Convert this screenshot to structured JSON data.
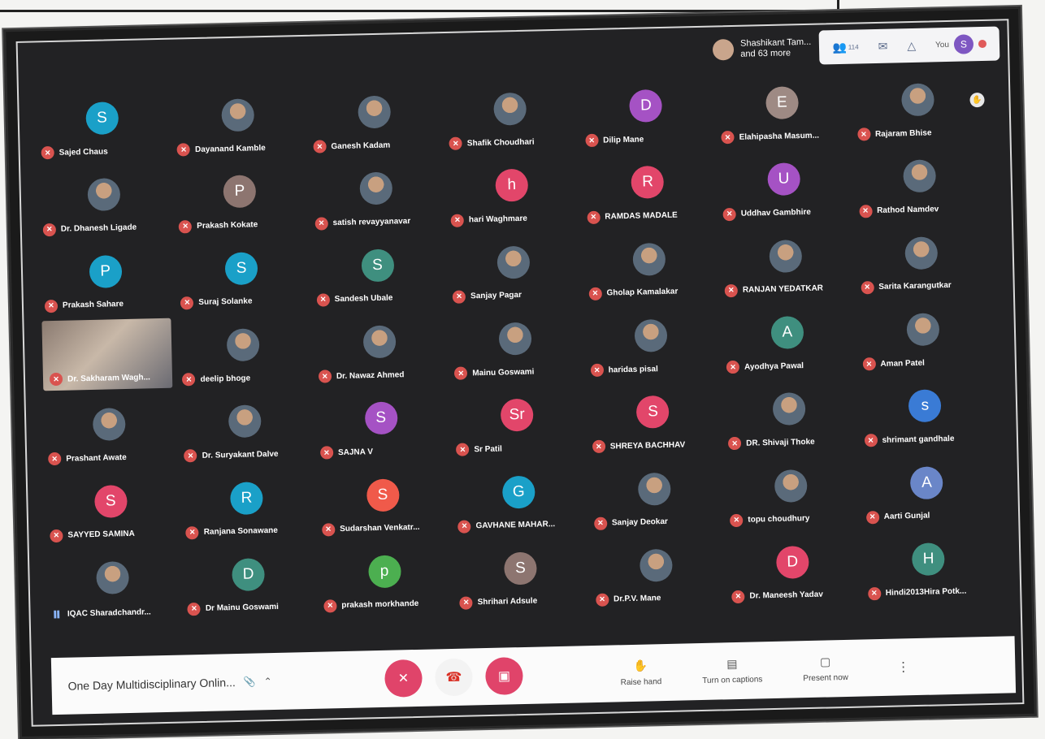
{
  "presenter": {
    "line1": "Shashikant Tam...",
    "line2": "and 63 more"
  },
  "topbar": {
    "participants_count": "114",
    "you_label": "You",
    "you_initial": "S"
  },
  "participants": [
    {
      "name": "Sajed Chaus",
      "initial": "S",
      "color": "#1aa0c8"
    },
    {
      "name": "Dayanand Kamble",
      "photo": true
    },
    {
      "name": "Ganesh Kadam",
      "photo": true
    },
    {
      "name": "Shafik Choudhari",
      "photo": true
    },
    {
      "name": "Dilip Mane",
      "initial": "D",
      "color": "#a552c4"
    },
    {
      "name": "Elahipasha Masum...",
      "initial": "E",
      "color": "#9e8a84"
    },
    {
      "name": "Rajaram Bhise",
      "photo": true,
      "hand": true
    },
    {
      "name": "Dr. Dhanesh Ligade",
      "photo": true
    },
    {
      "name": "Prakash Kokate",
      "initial": "P",
      "color": "#8d7570"
    },
    {
      "name": "satish revayyanavar",
      "photo": true
    },
    {
      "name": "hari Waghmare",
      "initial": "h",
      "color": "#e2466a"
    },
    {
      "name": "RAMDAS MADALE",
      "initial": "R",
      "color": "#e2466a"
    },
    {
      "name": "Uddhav Gambhire",
      "initial": "U",
      "color": "#a552c4"
    },
    {
      "name": "Rathod Namdev",
      "photo": true
    },
    {
      "name": "Prakash Sahare",
      "initial": "P",
      "color": "#1aa0c8"
    },
    {
      "name": "Suraj Solanke",
      "initial": "S",
      "color": "#1aa0c8"
    },
    {
      "name": "Sandesh Ubale",
      "initial": "S",
      "color": "#3f8f7f"
    },
    {
      "name": "Sanjay Pagar",
      "photo": true
    },
    {
      "name": "Gholap Kamalakar",
      "photo": true
    },
    {
      "name": "RANJAN YEDATKAR",
      "photo": true
    },
    {
      "name": "Sarita Karangutkar",
      "photo": true
    },
    {
      "name": "Dr. Sakharam Wagh...",
      "video": true
    },
    {
      "name": "deelip bhoge",
      "photo": true
    },
    {
      "name": "Dr. Nawaz Ahmed",
      "photo": true
    },
    {
      "name": "Mainu Goswami",
      "photo": true
    },
    {
      "name": "haridas pisal",
      "photo": true
    },
    {
      "name": "Ayodhya Pawal",
      "initial": "A",
      "color": "#3f8f7f"
    },
    {
      "name": "Aman Patel",
      "photo": true
    },
    {
      "name": "Prashant Awate",
      "photo": true
    },
    {
      "name": "Dr. Suryakant Dalve",
      "photo": true
    },
    {
      "name": "SAJNA V",
      "initial": "S",
      "color": "#a552c4"
    },
    {
      "name": "Sr Patil",
      "initial": "Sr",
      "color": "#e2466a"
    },
    {
      "name": "SHREYA BACHHAV",
      "initial": "S",
      "color": "#e2466a"
    },
    {
      "name": "DR. Shivaji Thoke",
      "photo": true
    },
    {
      "name": "shrimant gandhale",
      "initial": "s",
      "color": "#3a7bd5"
    },
    {
      "name": "SAYYED SAMINA",
      "initial": "S",
      "color": "#e2466a"
    },
    {
      "name": "Ranjana Sonawane",
      "initial": "R",
      "color": "#1aa0c8"
    },
    {
      "name": "Sudarshan Venkatr...",
      "initial": "S",
      "color": "#f05a4a"
    },
    {
      "name": "GAVHANE MAHAR...",
      "initial": "G",
      "color": "#1aa0c8"
    },
    {
      "name": "Sanjay Deokar",
      "photo": true
    },
    {
      "name": "topu choudhury",
      "photo": true
    },
    {
      "name": "Aarti Gunjal",
      "initial": "A",
      "color": "#6a86c8"
    },
    {
      "name": "IQAC Sharadchandr...",
      "photo": true,
      "speaking": true
    },
    {
      "name": "Dr Mainu Goswami",
      "initial": "D",
      "color": "#3f8f7f"
    },
    {
      "name": "prakash morkhande",
      "initial": "p",
      "color": "#4caf50"
    },
    {
      "name": "Shrihari Adsule",
      "initial": "S",
      "color": "#8d7570"
    },
    {
      "name": "Dr.P.V. Mane",
      "photo": true
    },
    {
      "name": "Dr. Maneesh Yadav",
      "initial": "D",
      "color": "#e2466a"
    },
    {
      "name": "Hindi2013Hira Potk...",
      "initial": "H",
      "color": "#3f8f7f"
    }
  ],
  "bottombar": {
    "meeting_title": "One Day Multidisciplinary Onlin...",
    "raise_hand": "Raise hand",
    "captions": "Turn on captions",
    "present": "Present now"
  },
  "icons": {
    "participants": "people-icon",
    "chat": "chat-icon",
    "activities": "activities-icon",
    "mic_off": "mic-off-icon",
    "hangup": "hangup-icon",
    "cam_off": "camera-off-icon",
    "hand": "hand-icon",
    "captions": "captions-icon",
    "present": "present-icon",
    "more": "more-vert-icon"
  },
  "colors": {
    "accent_red": "#e0446a",
    "tile_bg": "#222224",
    "bar_bg": "#fbfbfb"
  }
}
